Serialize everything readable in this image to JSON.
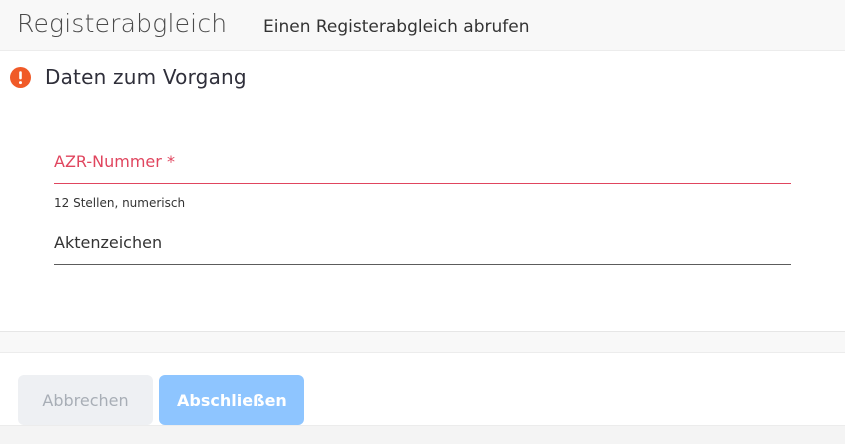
{
  "header": {
    "app_title": "Registerabgleich",
    "page_subtitle": "Einen Registerabgleich abrufen"
  },
  "section": {
    "title": "Daten zum Vorgang",
    "icon": "exclamation-circle-icon",
    "icon_color": "#f05a28"
  },
  "form": {
    "azr_nummer": {
      "label": "AZR-Nummer *",
      "value": "",
      "hint": "12 Stellen, numerisch",
      "state": "invalid",
      "label_color": "#e0455e"
    },
    "aktenzeichen": {
      "label": "Aktenzeichen",
      "value": ""
    }
  },
  "actions": {
    "cancel_label": "Abbrechen",
    "submit_label": "Abschließen",
    "submit_color": "#8ec5ff"
  }
}
